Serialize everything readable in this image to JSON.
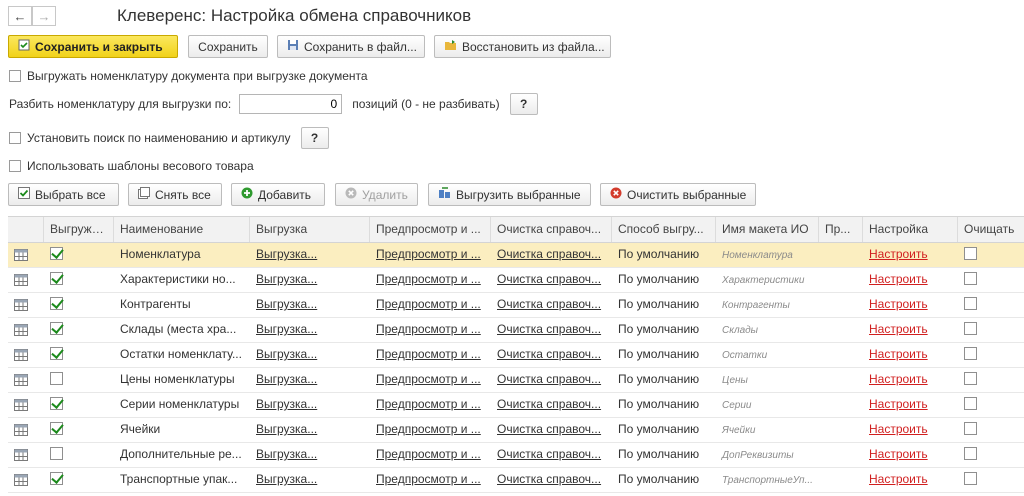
{
  "nav": {
    "back": "←",
    "forward": "→"
  },
  "title": "Клеверенс: Настройка обмена справочников",
  "toolbar": {
    "save_close": "Сохранить и закрыть",
    "save": "Сохранить",
    "save_file": "Сохранить в файл...",
    "restore_file": "Восстановить из файла..."
  },
  "options": {
    "export_nomenclature": "Выгружать номенклатуру документа при выгрузке документа",
    "split_label": "Разбить номенклатуру для выгрузки по:",
    "split_value": "0",
    "split_suffix": "позиций (0 - не разбивать)",
    "search_label": "Установить поиск по наименованию и артикулу",
    "weight_templates": "Использовать шаблоны весового товара",
    "help": "?"
  },
  "actions": {
    "select_all": "Выбрать все",
    "unselect_all": "Снять все",
    "add": "Добавить",
    "delete": "Удалить",
    "export_selected": "Выгрузить выбранные",
    "clear_selected": "Очистить выбранные"
  },
  "table": {
    "headers": [
      "",
      "Выгружать",
      "Наименование",
      "Выгрузка",
      "Предпросмотр и ...",
      "Очистка справоч...",
      "Способ выгру...",
      "Имя макета ИО",
      "Пр...",
      "Настройка",
      "Очищать"
    ],
    "rows": [
      {
        "export": true,
        "name": "Номенклатура",
        "unload": "Выгрузка...",
        "preview": "Предпросмотр и ...",
        "clean": "Очистка справоч...",
        "method": "По умолчанию",
        "layout": "Номенклатура",
        "setup": "Настроить"
      },
      {
        "export": true,
        "name": "Характеристики но...",
        "unload": "Выгрузка...",
        "preview": "Предпросмотр и ...",
        "clean": "Очистка справоч...",
        "method": "По умолчанию",
        "layout": "Характеристики",
        "setup": "Настроить"
      },
      {
        "export": true,
        "name": "Контрагенты",
        "unload": "Выгрузка...",
        "preview": "Предпросмотр и ...",
        "clean": "Очистка справоч...",
        "method": "По умолчанию",
        "layout": "Контрагенты",
        "setup": "Настроить"
      },
      {
        "export": true,
        "name": "Склады (места хра...",
        "unload": "Выгрузка...",
        "preview": "Предпросмотр и ...",
        "clean": "Очистка справоч...",
        "method": "По умолчанию",
        "layout": "Склады",
        "setup": "Настроить"
      },
      {
        "export": true,
        "name": "Остатки номенклату...",
        "unload": "Выгрузка...",
        "preview": "Предпросмотр и ...",
        "clean": "Очистка справоч...",
        "method": "По умолчанию",
        "layout": "Остатки",
        "setup": "Настроить"
      },
      {
        "export": false,
        "name": "Цены номенклатуры",
        "unload": "Выгрузка...",
        "preview": "Предпросмотр и ...",
        "clean": "Очистка справоч...",
        "method": "По умолчанию",
        "layout": "Цены",
        "setup": "Настроить"
      },
      {
        "export": true,
        "name": "Серии номенклатуры",
        "unload": "Выгрузка...",
        "preview": "Предпросмотр и ...",
        "clean": "Очистка справоч...",
        "method": "По умолчанию",
        "layout": "Серии",
        "setup": "Настроить"
      },
      {
        "export": true,
        "name": "Ячейки",
        "unload": "Выгрузка...",
        "preview": "Предпросмотр и ...",
        "clean": "Очистка справоч...",
        "method": "По умолчанию",
        "layout": "Ячейки",
        "setup": "Настроить"
      },
      {
        "export": false,
        "name": "Дополнительные ре...",
        "unload": "Выгрузка...",
        "preview": "Предпросмотр и ...",
        "clean": "Очистка справоч...",
        "method": "По умолчанию",
        "layout": "ДопРеквизиты",
        "setup": "Настроить"
      },
      {
        "export": true,
        "name": "Транспортные упак...",
        "unload": "Выгрузка...",
        "preview": "Предпросмотр и ...",
        "clean": "Очистка справоч...",
        "method": "По умолчанию",
        "layout": "ТранспортныеУп...",
        "setup": "Настроить"
      }
    ]
  },
  "colors": {
    "primary": "#f1d21a",
    "link_red": "#d11f1f",
    "selected_row": "#fbeec0",
    "check": "#1b8a1b"
  }
}
